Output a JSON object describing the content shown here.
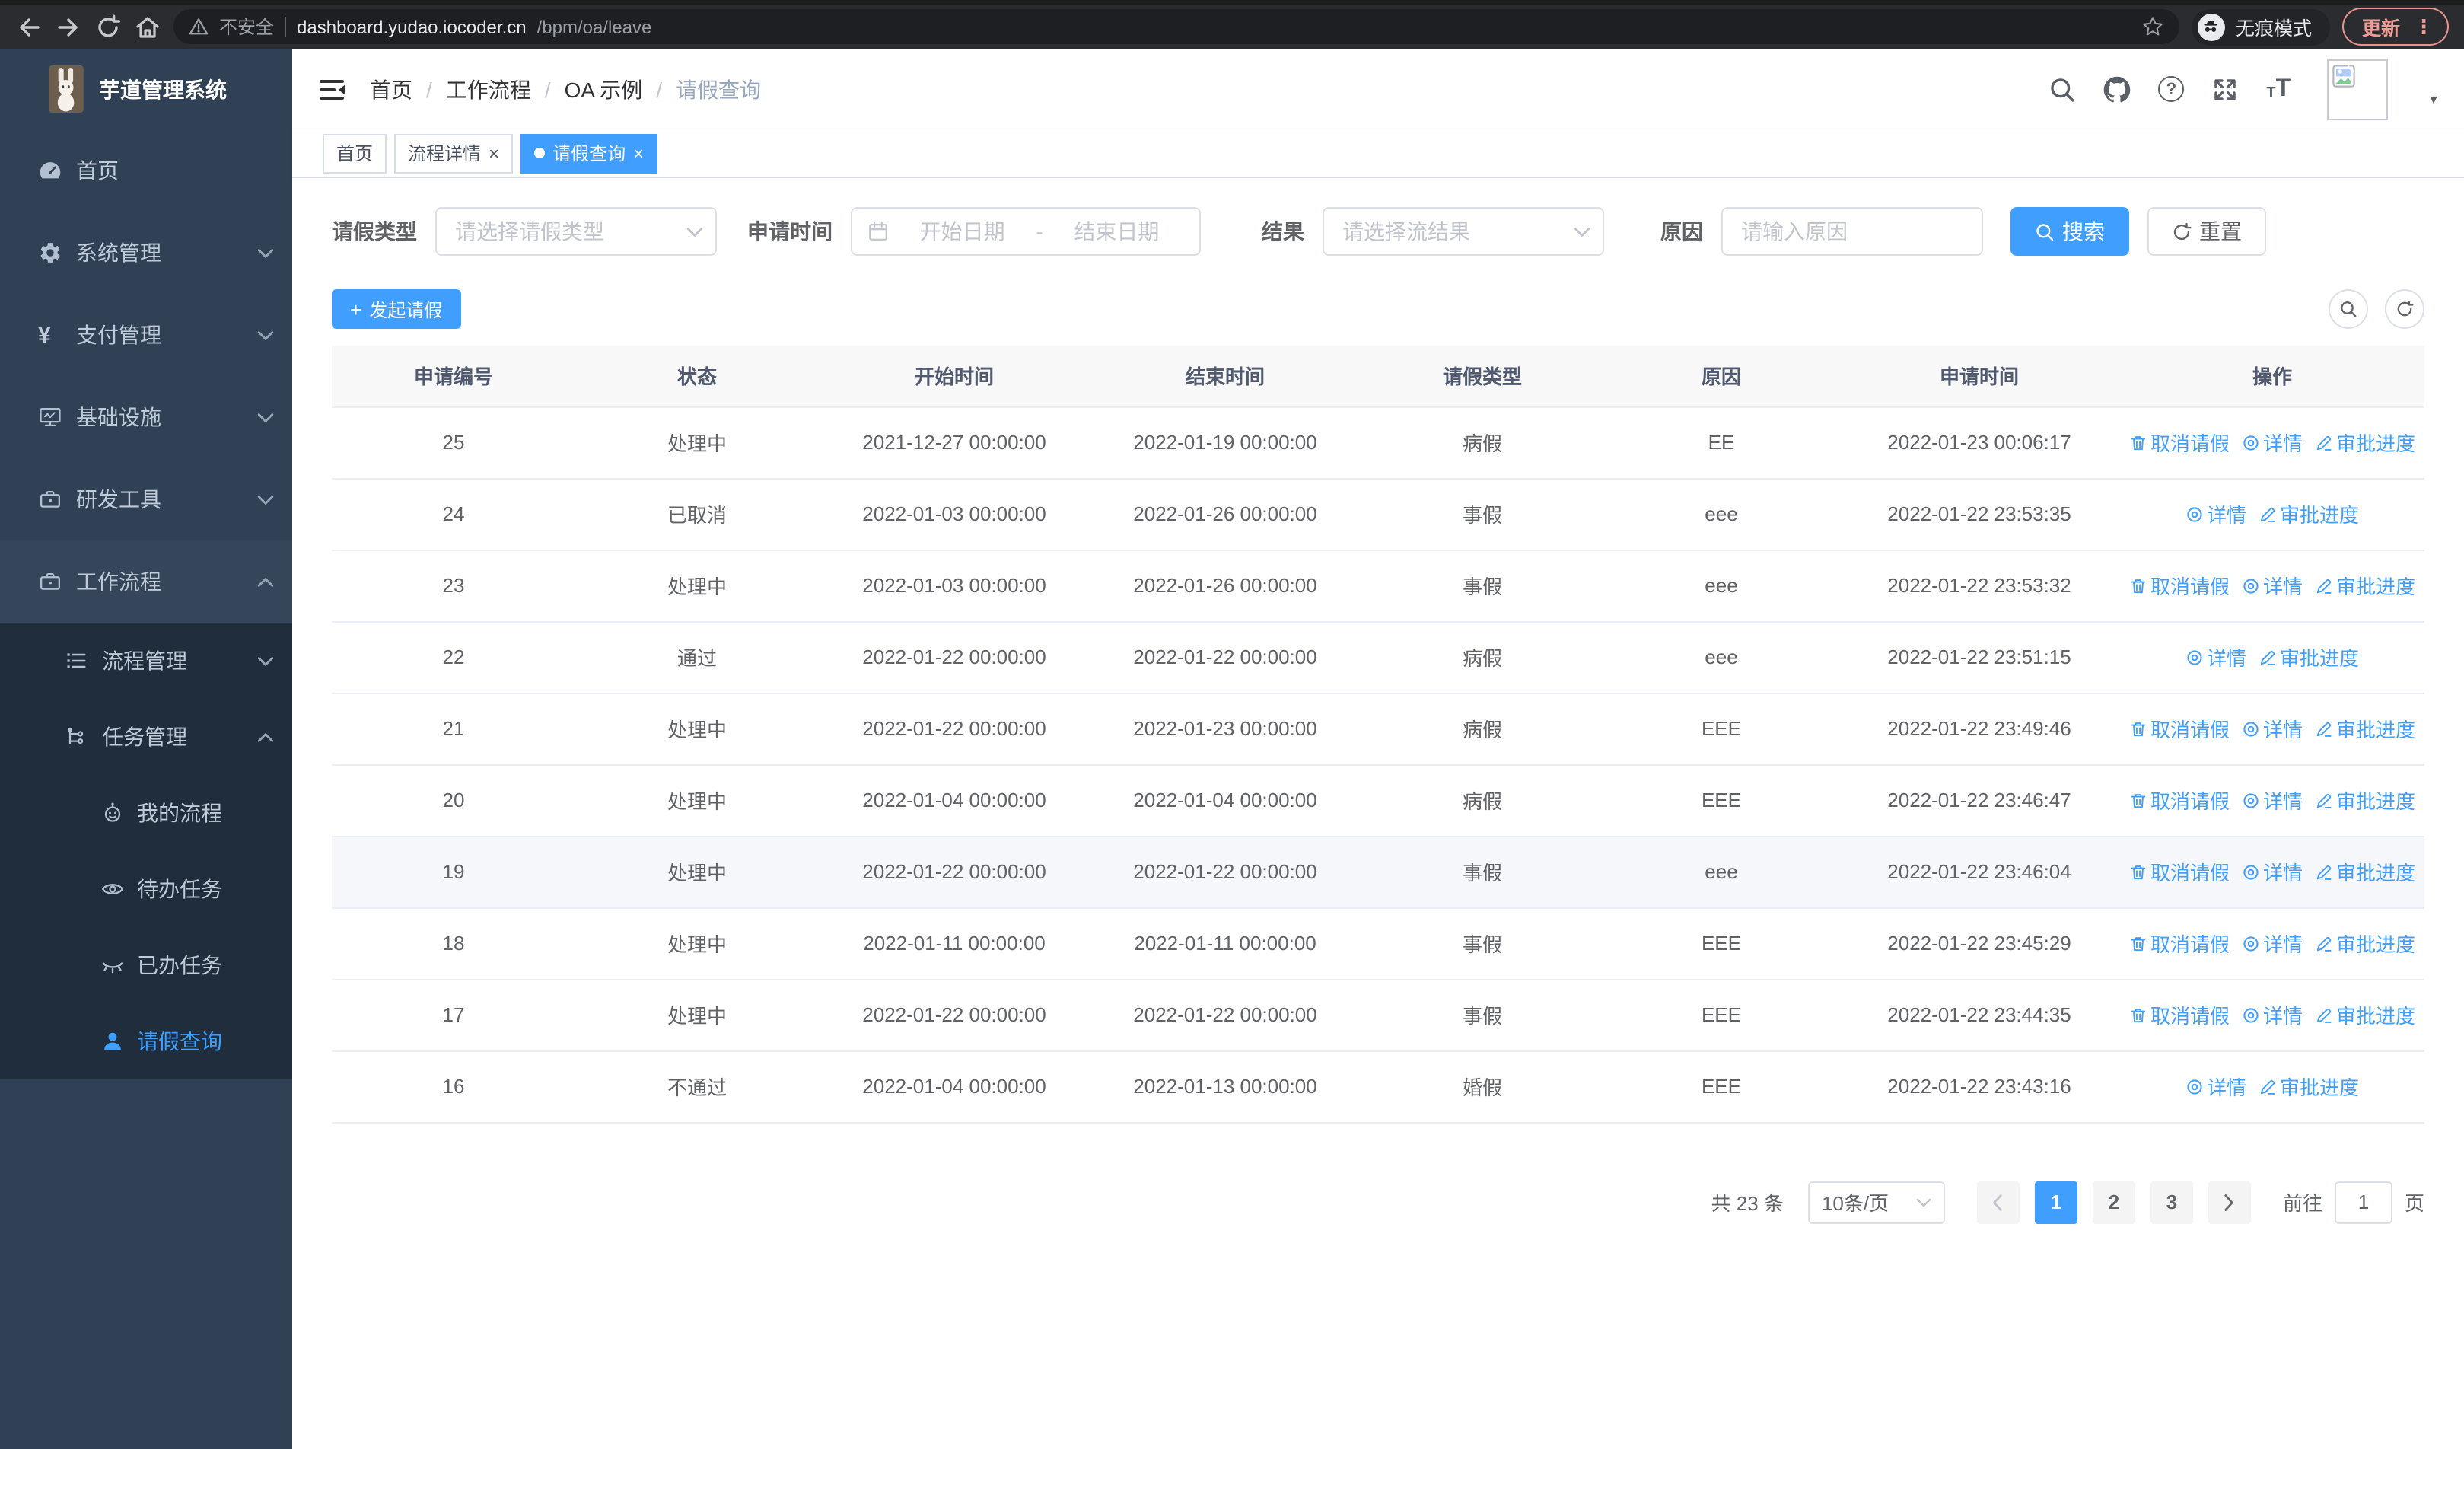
{
  "browser": {
    "security_label": "不安全",
    "url_host": "dashboard.yudao.iocoder.cn",
    "url_path": "/bpm/oa/leave",
    "incognito_label": "无痕模式",
    "update_label": "更新"
  },
  "sidebar": {
    "title": "芋道管理系统",
    "items": [
      {
        "label": "首页"
      },
      {
        "label": "系统管理"
      },
      {
        "label": "支付管理"
      },
      {
        "label": "基础设施"
      },
      {
        "label": "研发工具"
      },
      {
        "label": "工作流程"
      },
      {
        "label": "流程管理"
      },
      {
        "label": "任务管理"
      },
      {
        "label": "我的流程"
      },
      {
        "label": "待办任务"
      },
      {
        "label": "已办任务"
      },
      {
        "label": "请假查询"
      }
    ]
  },
  "navbar": {
    "breadcrumb": [
      {
        "label": "首页"
      },
      {
        "label": "工作流程"
      },
      {
        "label": "OA 示例"
      },
      {
        "label": "请假查询"
      }
    ]
  },
  "tabs": [
    {
      "label": "首页"
    },
    {
      "label": "流程详情"
    },
    {
      "label": "请假查询"
    }
  ],
  "filters": {
    "leave_type_label": "请假类型",
    "leave_type_placeholder": "请选择请假类型",
    "apply_time_label": "申请时间",
    "start_date_placeholder": "开始日期",
    "range_separator": "-",
    "end_date_placeholder": "结束日期",
    "result_label": "结果",
    "result_placeholder": "请选择流结果",
    "reason_label": "原因",
    "reason_placeholder": "请输入原因",
    "search_label": "搜索",
    "reset_label": "重置"
  },
  "toolbar": {
    "create_label": "发起请假"
  },
  "table": {
    "columns": [
      "申请编号",
      "状态",
      "开始时间",
      "结束时间",
      "请假类型",
      "原因",
      "申请时间",
      "操作"
    ],
    "action_labels": {
      "cancel": "取消请假",
      "detail": "详情",
      "progress": "审批进度"
    },
    "rows": [
      {
        "id": "25",
        "status": "处理中",
        "start": "2021-12-27 00:00:00",
        "end": "2022-01-19 00:00:00",
        "type": "病假",
        "reason": "EE",
        "apply_time": "2022-01-23 00:06:17",
        "can_cancel": true
      },
      {
        "id": "24",
        "status": "已取消",
        "start": "2022-01-03 00:00:00",
        "end": "2022-01-26 00:00:00",
        "type": "事假",
        "reason": "eee",
        "apply_time": "2022-01-22 23:53:35",
        "can_cancel": false
      },
      {
        "id": "23",
        "status": "处理中",
        "start": "2022-01-03 00:00:00",
        "end": "2022-01-26 00:00:00",
        "type": "事假",
        "reason": "eee",
        "apply_time": "2022-01-22 23:53:32",
        "can_cancel": true
      },
      {
        "id": "22",
        "status": "通过",
        "start": "2022-01-22 00:00:00",
        "end": "2022-01-22 00:00:00",
        "type": "病假",
        "reason": "eee",
        "apply_time": "2022-01-22 23:51:15",
        "can_cancel": false
      },
      {
        "id": "21",
        "status": "处理中",
        "start": "2022-01-22 00:00:00",
        "end": "2022-01-23 00:00:00",
        "type": "病假",
        "reason": "EEE",
        "apply_time": "2022-01-22 23:49:46",
        "can_cancel": true
      },
      {
        "id": "20",
        "status": "处理中",
        "start": "2022-01-04 00:00:00",
        "end": "2022-01-04 00:00:00",
        "type": "病假",
        "reason": "EEE",
        "apply_time": "2022-01-22 23:46:47",
        "can_cancel": true
      },
      {
        "id": "19",
        "status": "处理中",
        "start": "2022-01-22 00:00:00",
        "end": "2022-01-22 00:00:00",
        "type": "事假",
        "reason": "eee",
        "apply_time": "2022-01-22 23:46:04",
        "can_cancel": true
      },
      {
        "id": "18",
        "status": "处理中",
        "start": "2022-01-11 00:00:00",
        "end": "2022-01-11 00:00:00",
        "type": "事假",
        "reason": "EEE",
        "apply_time": "2022-01-22 23:45:29",
        "can_cancel": true
      },
      {
        "id": "17",
        "status": "处理中",
        "start": "2022-01-22 00:00:00",
        "end": "2022-01-22 00:00:00",
        "type": "事假",
        "reason": "EEE",
        "apply_time": "2022-01-22 23:44:35",
        "can_cancel": true
      },
      {
        "id": "16",
        "status": "不通过",
        "start": "2022-01-04 00:00:00",
        "end": "2022-01-13 00:00:00",
        "type": "婚假",
        "reason": "EEE",
        "apply_time": "2022-01-22 23:43:16",
        "can_cancel": false
      }
    ]
  },
  "pagination": {
    "total_label": "共 23 条",
    "page_size_label": "10条/页",
    "pages": [
      "1",
      "2",
      "3"
    ],
    "goto_label": "前往",
    "goto_value": "1",
    "page_unit_label": "页"
  },
  "colors": {
    "primary": "#409eff",
    "sidebar_bg": "#304156",
    "submenu_bg": "#1f2d3d",
    "update_accent": "#f28b82"
  }
}
